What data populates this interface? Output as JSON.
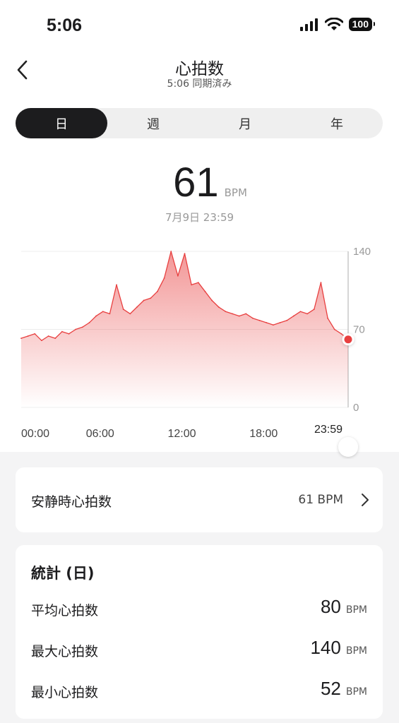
{
  "status_bar": {
    "time": "5:06",
    "battery": "100",
    "icons": [
      "signal-icon",
      "wifi-icon",
      "battery-icon"
    ]
  },
  "header": {
    "title": "心拍数",
    "subtitle": "5:06 同期済み",
    "back_icon": "chevron-left-icon"
  },
  "tabs": [
    {
      "label": "日",
      "active": true
    },
    {
      "label": "週",
      "active": false
    },
    {
      "label": "月",
      "active": false
    },
    {
      "label": "年",
      "active": false
    }
  ],
  "current": {
    "value": "61",
    "unit": "BPM",
    "date": "7月9日 23:59"
  },
  "colors": {
    "accent": "#e84040",
    "dark": "#1c1c1e",
    "bg": "#f4f4f5"
  },
  "chart_data": {
    "type": "area",
    "xlabel": "",
    "ylabel": "",
    "x_ticks": [
      "00:00",
      "06:00",
      "12:00",
      "18:00"
    ],
    "selected_label": "23:59",
    "y_ticks": [
      "140",
      "70",
      "0"
    ],
    "ylim": [
      0,
      140
    ],
    "xlim": [
      0,
      24
    ],
    "grid": true,
    "x": [
      0,
      0.5,
      1,
      1.5,
      2,
      2.5,
      3,
      3.5,
      4,
      4.5,
      5,
      5.5,
      6,
      6.5,
      7,
      7.5,
      8,
      8.5,
      9,
      9.5,
      10,
      10.5,
      11,
      11.5,
      12,
      12.5,
      13,
      13.5,
      14,
      14.5,
      15,
      15.5,
      16,
      16.5,
      17,
      17.5,
      18,
      18.5,
      19,
      19.5,
      20,
      20.5,
      21,
      21.5,
      22,
      22.5,
      23,
      23.5,
      24
    ],
    "values": [
      62,
      64,
      66,
      60,
      64,
      62,
      68,
      66,
      70,
      72,
      76,
      82,
      86,
      84,
      110,
      88,
      84,
      90,
      96,
      98,
      104,
      116,
      140,
      118,
      138,
      110,
      112,
      104,
      96,
      90,
      86,
      84,
      82,
      84,
      80,
      78,
      76,
      74,
      76,
      78,
      82,
      86,
      84,
      88,
      112,
      80,
      70,
      66,
      61
    ],
    "selected": {
      "x": 24,
      "y": 61
    }
  },
  "resting": {
    "label": "安静時心拍数",
    "value": "61 BPM"
  },
  "stats": {
    "title": "統計 (日)",
    "rows": [
      {
        "label": "平均心拍数",
        "value": "80",
        "unit": "BPM"
      },
      {
        "label": "最大心拍数",
        "value": "140",
        "unit": "BPM"
      },
      {
        "label": "最小心拍数",
        "value": "52",
        "unit": "BPM"
      }
    ]
  }
}
